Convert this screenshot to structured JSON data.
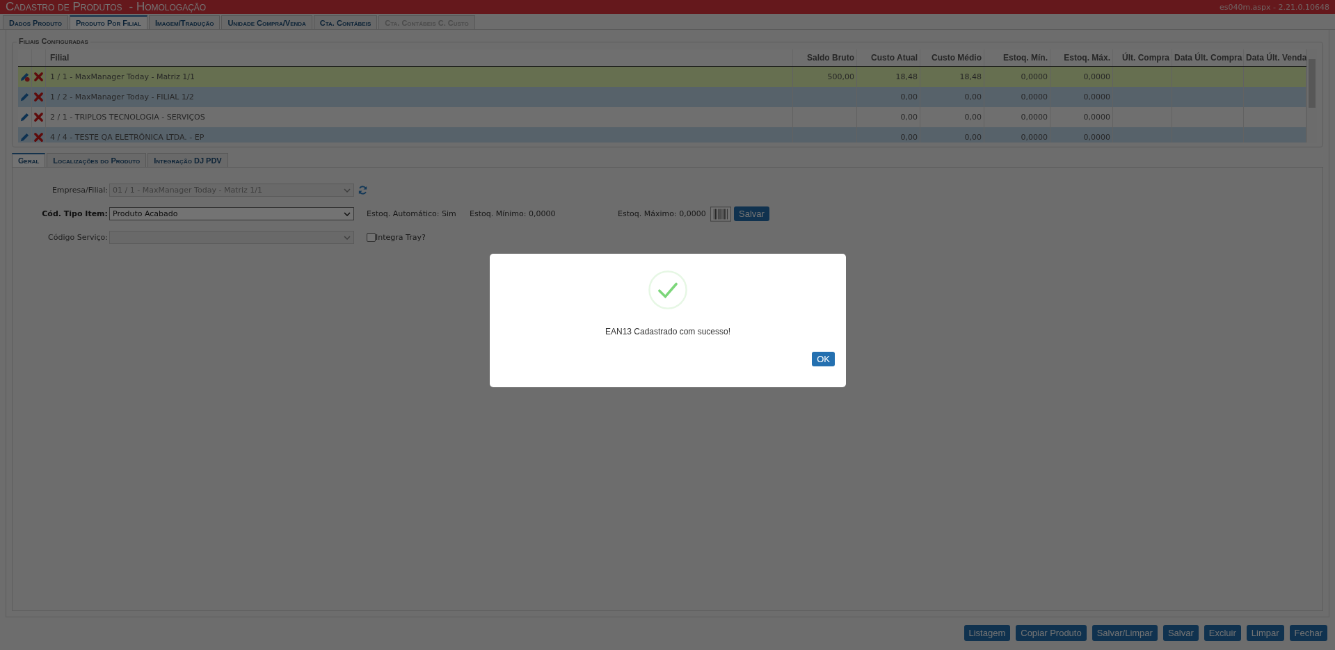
{
  "window": {
    "title": "Cadastro de Produtos",
    "environment": "- Homologação",
    "page_info": "es040m.aspx - 2.21.0.10648"
  },
  "tabs": [
    {
      "label": "Dados Produto",
      "selected": false,
      "disabled": false
    },
    {
      "label": "Produto Por Filial",
      "selected": true,
      "disabled": false
    },
    {
      "label": "Imagem/Tradução",
      "selected": false,
      "disabled": false
    },
    {
      "label": "Unidade Compra/Venda",
      "selected": false,
      "disabled": false
    },
    {
      "label": "Cta. Contábeis",
      "selected": false,
      "disabled": false
    },
    {
      "label": "Cta. Contábeis C. Custo",
      "selected": false,
      "disabled": true
    }
  ],
  "branches": {
    "legend": "Filiais Configuradas",
    "columns": [
      "Filial",
      "Saldo Bruto",
      "Custo Atual",
      "Custo Médio",
      "Estoq. Mín.",
      "Estoq. Máx.",
      "Últ. Compra",
      "Data Últ. Compra",
      "Data Últ. Venda"
    ],
    "rows": [
      {
        "selected": true,
        "editing": true,
        "cells": [
          "1 / 1 - MaxManager Today - Matriz 1/1",
          "500,00",
          "18,48",
          "18,48",
          "0,0000",
          "0,0000",
          "",
          "",
          ""
        ]
      },
      {
        "selected": false,
        "editing": false,
        "cells": [
          "1 / 2 - MaxManager Today - FILIAL 1/2",
          "",
          "0,00",
          "0,00",
          "0,0000",
          "0,0000",
          "",
          "",
          ""
        ]
      },
      {
        "selected": false,
        "editing": false,
        "cells": [
          "2 / 1 - TRIPLOS TECNOLOGIA - SERVIÇOS",
          "",
          "0,00",
          "0,00",
          "0,0000",
          "0,0000",
          "",
          "",
          ""
        ]
      },
      {
        "selected": false,
        "editing": false,
        "cells": [
          "4 / 4 - TESTE QA ELETRÔNICA LTDA. - EP",
          "",
          "0,00",
          "0,00",
          "0,0000",
          "0,0000",
          "",
          "",
          ""
        ]
      }
    ]
  },
  "sub_tabs": [
    {
      "label": "Geral",
      "selected": true
    },
    {
      "label": "Localizações do Produto",
      "selected": false
    },
    {
      "label": "Integração DJ PDV",
      "selected": false
    }
  ],
  "form": {
    "company": {
      "label": "Empresa/Filial:",
      "value": "01 / 1 - MaxManager Today - Matriz 1/1",
      "disabled": true,
      "required": false
    },
    "item_type": {
      "label": "Cód. Tipo Item:",
      "value": "Produto Acabado",
      "disabled": false,
      "required": true
    },
    "auto_stock": "Estoq. Automático: Sim",
    "min_stock": "Estoq. Mínimo: 0,0000",
    "max_stock": "Estoq. Máximo: 0,0000",
    "save_button": "Salvar",
    "service_code": {
      "label": "Código Serviço:",
      "disabled": true,
      "required": false
    },
    "tray": {
      "label": "Integra Tray?",
      "checked": false
    }
  },
  "footer_buttons": [
    "Listagem",
    "Copiar Produto",
    "Salvar/Limpar",
    "Salvar",
    "Excluir",
    "Limpar",
    "Fechar"
  ],
  "dialog": {
    "message": "EAN13 Cadastrado com sucesso!",
    "ok": "OK"
  }
}
